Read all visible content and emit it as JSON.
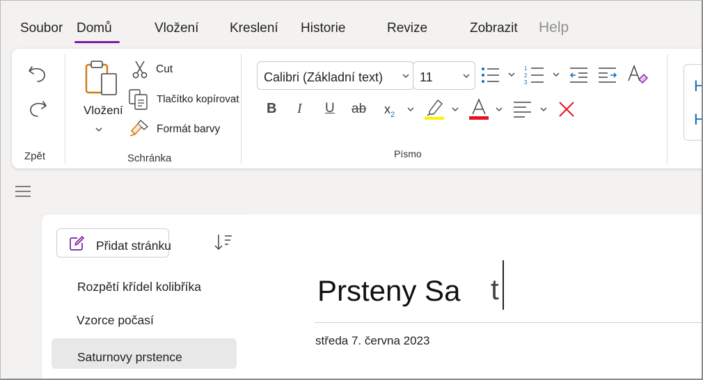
{
  "menu": {
    "tabs": [
      "Soubor",
      "Domů",
      "Vložení",
      "Kreslení",
      "Historie",
      "Revize",
      "Zobrazit",
      "Help"
    ],
    "active_index": 1
  },
  "ribbon": {
    "undo_group": {
      "label": "Zpět"
    },
    "clipboard": {
      "paste_label": "Vložení",
      "cut_label": "Cut",
      "copy_label": "Tlačítko kopírovat",
      "format_painter_label": "Formát barvy",
      "group_label": "Schránka"
    },
    "font": {
      "font_name": "Calibri (Základní text)",
      "font_size": "11",
      "group_label": "Písmo",
      "highlight_color": "#ffef00",
      "font_color": "#e81123",
      "clear_color": "#e81123"
    },
    "styles_preview_glyph": "H"
  },
  "pages": {
    "add_page_label": "Přidat stránku",
    "items": [
      {
        "title": "Rozpětí křídel kolibříka",
        "selected": false
      },
      {
        "title": "Vzorce počasí",
        "selected": false
      },
      {
        "title": "Saturnovy prstence",
        "selected": true
      }
    ]
  },
  "note": {
    "title": "Prsteny Sa",
    "title_cursor_char": "t",
    "date": "středa 7. června 2023"
  },
  "colors": {
    "accent": "#7a1fa2",
    "icon_blue": "#0f6cbd"
  }
}
